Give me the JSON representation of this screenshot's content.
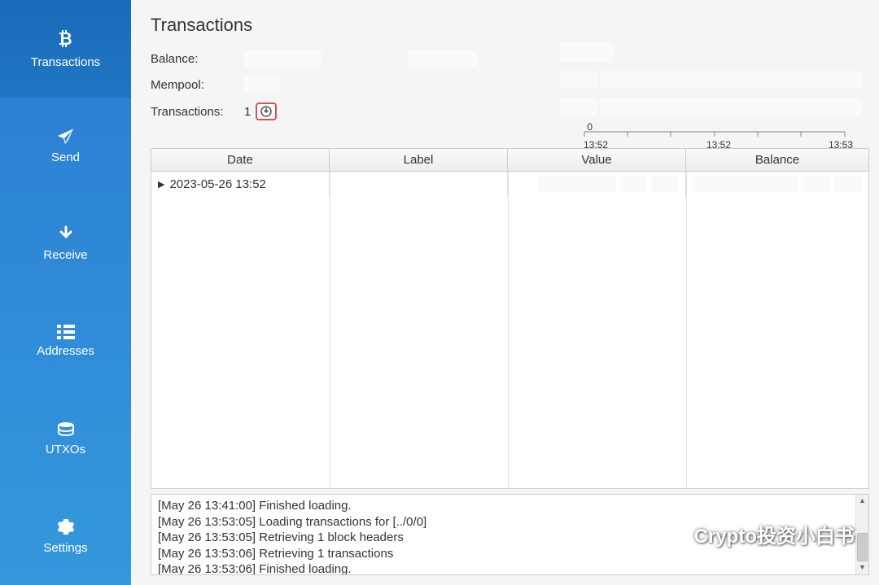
{
  "sidebar": {
    "items": [
      {
        "label": "Transactions",
        "icon": "bitcoin",
        "active": true
      },
      {
        "label": "Send",
        "icon": "paper-plane",
        "active": false
      },
      {
        "label": "Receive",
        "icon": "arrow-down",
        "active": false
      },
      {
        "label": "Addresses",
        "icon": "list",
        "active": false
      },
      {
        "label": "UTXOs",
        "icon": "stack",
        "active": false
      },
      {
        "label": "Settings",
        "icon": "gear",
        "active": false
      }
    ]
  },
  "page": {
    "title": "Transactions"
  },
  "info": {
    "balance_label": "Balance:",
    "mempool_label": "Mempool:",
    "transactions_label": "Transactions:",
    "transactions_count": "1"
  },
  "chart_data": {
    "type": "line",
    "x_ticks": [
      "13:52",
      "13:52",
      "13:53"
    ],
    "y_label": "0",
    "title": "",
    "xlabel": "",
    "ylabel": ""
  },
  "table": {
    "columns": [
      "Date",
      "Label",
      "Value",
      "Balance"
    ],
    "rows": [
      {
        "date": "2023-05-26 13:52",
        "label": "",
        "value": "",
        "balance": ""
      }
    ]
  },
  "log": {
    "lines": [
      "[May 26 13:41:00] Finished loading.",
      "[May 26 13:53:05] Loading transactions for [../0/0]",
      "[May 26 13:53:05] Retrieving 1 block headers",
      "[May 26 13:53:06] Retrieving 1 transactions",
      "[May 26 13:53:06] Finished loading."
    ]
  },
  "watermark": {
    "text": "Crypto投资小白书"
  }
}
